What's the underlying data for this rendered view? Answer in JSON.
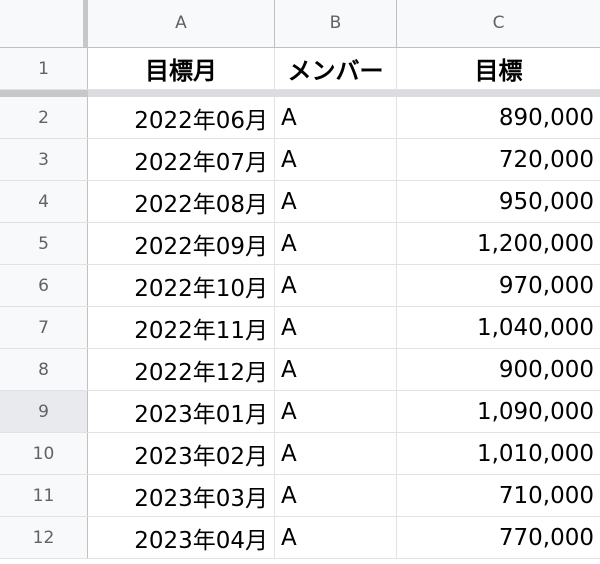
{
  "columns": [
    "A",
    "B",
    "C"
  ],
  "header_row": {
    "num": "1",
    "a": "目標月",
    "b": "メンバー",
    "c": "目標"
  },
  "rows": [
    {
      "num": "2",
      "a": "2022年06月",
      "b": "A",
      "c": "890,000"
    },
    {
      "num": "3",
      "a": "2022年07月",
      "b": "A",
      "c": "720,000"
    },
    {
      "num": "4",
      "a": "2022年08月",
      "b": "A",
      "c": "950,000"
    },
    {
      "num": "5",
      "a": "2022年09月",
      "b": "A",
      "c": "1,200,000"
    },
    {
      "num": "6",
      "a": "2022年10月",
      "b": "A",
      "c": "970,000"
    },
    {
      "num": "7",
      "a": "2022年11月",
      "b": "A",
      "c": "1,040,000"
    },
    {
      "num": "8",
      "a": "2022年12月",
      "b": "A",
      "c": "900,000"
    },
    {
      "num": "9",
      "a": "2023年01月",
      "b": "A",
      "c": "1,090,000"
    },
    {
      "num": "10",
      "a": "2023年02月",
      "b": "A",
      "c": "1,010,000"
    },
    {
      "num": "11",
      "a": "2023年03月",
      "b": "A",
      "c": "710,000"
    },
    {
      "num": "12",
      "a": "2023年04月",
      "b": "A",
      "c": "770,000"
    }
  ],
  "selected_row": "9"
}
